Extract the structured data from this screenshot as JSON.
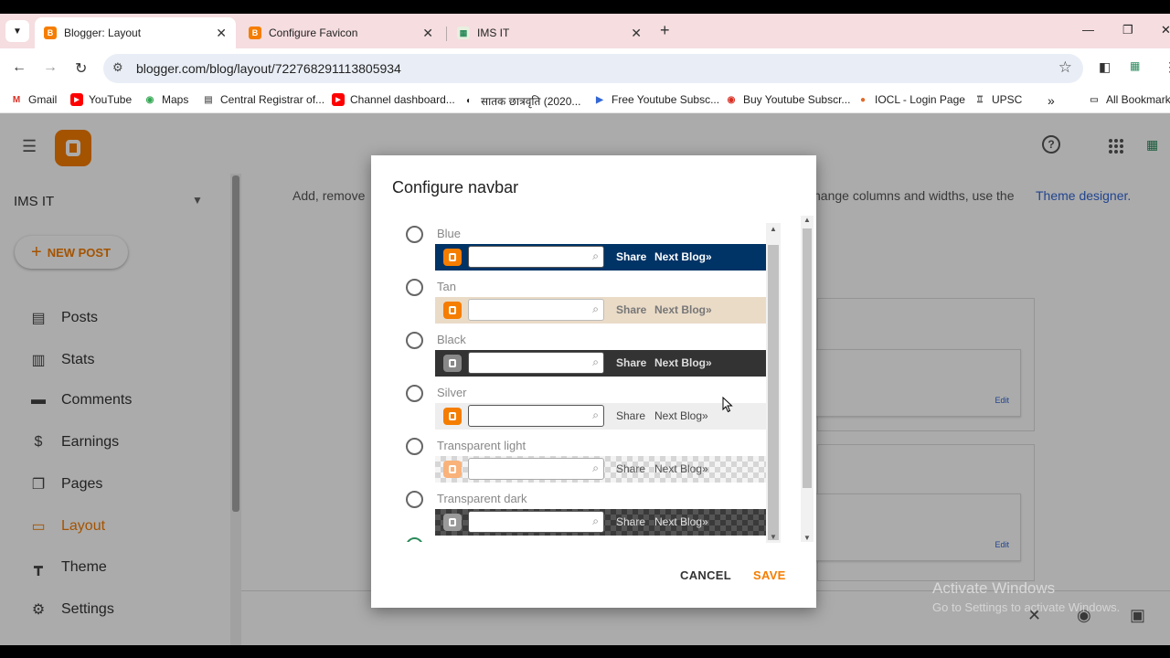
{
  "browser": {
    "tabs": [
      {
        "title": "Blogger: Layout",
        "active": true
      },
      {
        "title": "Configure Favicon",
        "active": false
      },
      {
        "title": "IMS IT",
        "active": false
      }
    ],
    "url": "blogger.com/blog/layout/722768291113805934",
    "bookmarks": [
      "Gmail",
      "YouTube",
      "Maps",
      "Central Registrar of...",
      "Channel dashboard...",
      "सातक छात्रवृति (2020...",
      "Free Youtube Subsc...",
      "Buy Youtube Subscr...",
      "IOCL - Login Page",
      "UPSC"
    ],
    "all_bookmarks": "All Bookmark"
  },
  "sidebar": {
    "blog_name": "IMS IT",
    "new_post": "NEW POST",
    "items": [
      {
        "label": "Posts",
        "icon": "posts-icon"
      },
      {
        "label": "Stats",
        "icon": "stats-icon"
      },
      {
        "label": "Comments",
        "icon": "comments-icon"
      },
      {
        "label": "Earnings",
        "icon": "earnings-icon"
      },
      {
        "label": "Pages",
        "icon": "pages-icon"
      },
      {
        "label": "Layout",
        "icon": "layout-icon",
        "active": true
      },
      {
        "label": "Theme",
        "icon": "theme-icon"
      },
      {
        "label": "Settings",
        "icon": "settings-icon"
      }
    ]
  },
  "main": {
    "info_start": "Add, remove",
    "info_mid": "hange columns and widths, use the",
    "info_link": "Theme designer.",
    "edit_label": "Edit"
  },
  "dialog": {
    "title": "Configure navbar",
    "nav_share": "Share",
    "nav_next": "Next Blog»",
    "options": [
      {
        "label": "Blue",
        "bg": "#003366",
        "text_color": "#ffffff",
        "logo_bg": "#f57d00"
      },
      {
        "label": "Tan",
        "bg": "#eadbc7",
        "text_color": "#777777",
        "logo_bg": "#f57d00"
      },
      {
        "label": "Black",
        "bg": "#333333",
        "text_color": "#dddddd",
        "logo_bg": "#888888"
      },
      {
        "label": "Silver",
        "bg": "#eeeeee",
        "text_color": "#444444",
        "logo_bg": "#f57d00"
      },
      {
        "label": "Transparent light",
        "bg": "checker-light",
        "text_color": "#555555",
        "logo_bg": "#f9b27a"
      },
      {
        "label": "Transparent dark",
        "bg": "checker-dark",
        "text_color": "#e0e0e0",
        "logo_bg": "#9a9a9a"
      }
    ],
    "cancel": "CANCEL",
    "save": "SAVE"
  },
  "watermark": {
    "line1": "Activate Windows",
    "line2": "Go to Settings to activate Windows."
  },
  "colors": {
    "accent": "#f57d00",
    "link": "#3367d6"
  }
}
